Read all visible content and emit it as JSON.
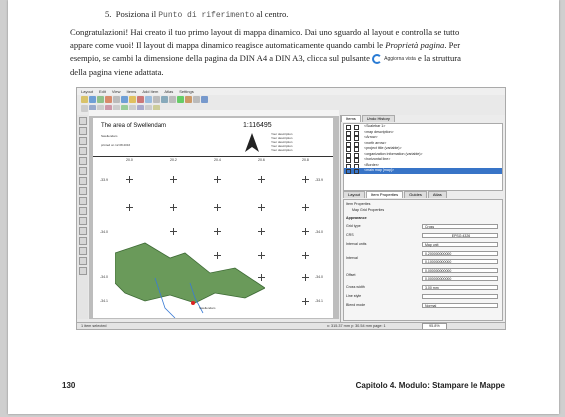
{
  "step": {
    "num": "5.",
    "pre": "Posiziona il",
    "code": "Punto di riferimento",
    "post": "al centro."
  },
  "para": {
    "line1": "Congratulazioni! Hai creato il tuo primo layout di mappa dinamico. Dai uno sguardo al layout e controlla se tutto",
    "line2a": "appare come vuoi! Il layout di mappa dinamico reagisce automaticamente quando cambi le",
    "line2b": "Proprietà pagina",
    "line2c": ". Per",
    "line3a": "esempio, se cambi la dimensione della pagina da DIN A4 a DIN A3, clicca sul pulsante",
    "line3b": "e la struttura",
    "line4": "della pagina viene adattata.",
    "button_label": "Aggiorna vista"
  },
  "screenshot": {
    "menu": [
      "Layout",
      "Edit",
      "View",
      "Items",
      "Add Item",
      "Atlas",
      "Settings"
    ],
    "map_title": "The area of Swellendam",
    "map_scale": "1:116495",
    "map_sub1": "Swellendam",
    "map_sub2": "printed on 12.08.2016",
    "map_notes": [
      "Your description",
      "Your description",
      "Your description",
      "Your description",
      "Your description"
    ],
    "x_coords": [
      "20.0",
      "20.2",
      "20.4",
      "20.6",
      "20.8"
    ],
    "y_coords": [
      "-33.9",
      "-34.0",
      "-34.0",
      "-34.1"
    ],
    "town_label": "Swellendam",
    "tabs_top": [
      "Items",
      "Undo History"
    ],
    "items": [
      "<Scalebar 1>",
      "<map description>",
      "<Arrow>",
      "<north arrow>",
      "<project title (variable)>",
      "<organization information (variable)>",
      "<horizontal line>",
      "<Border>",
      "<main map [map]>"
    ],
    "tabs_bottom": [
      "Layout",
      "Item Properties",
      "Guides",
      "Atlas"
    ],
    "prop_header": "Item Properties",
    "prop_section": "Map Grid Properties",
    "prop_sub": "Appearance",
    "props": [
      {
        "label": "Grid type",
        "value": "Cross"
      },
      {
        "label": "CRS",
        "value": "EPSG:4326"
      },
      {
        "label": "Interval units",
        "value": "Map unit"
      },
      {
        "label": "Interval",
        "value": "0.200000000000"
      },
      {
        "label": "",
        "value": "0.100000000000"
      },
      {
        "label": "Offset",
        "value": "0.000000000000"
      },
      {
        "label": "",
        "value": "0.000000000000"
      },
      {
        "label": "Cross width",
        "value": "3.00 mm"
      },
      {
        "label": "Line style",
        "value": ""
      },
      {
        "label": "Blend mode",
        "value": "Normal"
      }
    ],
    "status_left": "1 item selected",
    "status_mid": "x: 315.37 mm  y: 30.54 mm  page: 1",
    "status_zoom": "95.8%"
  },
  "footer": {
    "page_num": "130",
    "chapter": "Capitolo 4.  Modulo: Stampare le Mappe"
  }
}
